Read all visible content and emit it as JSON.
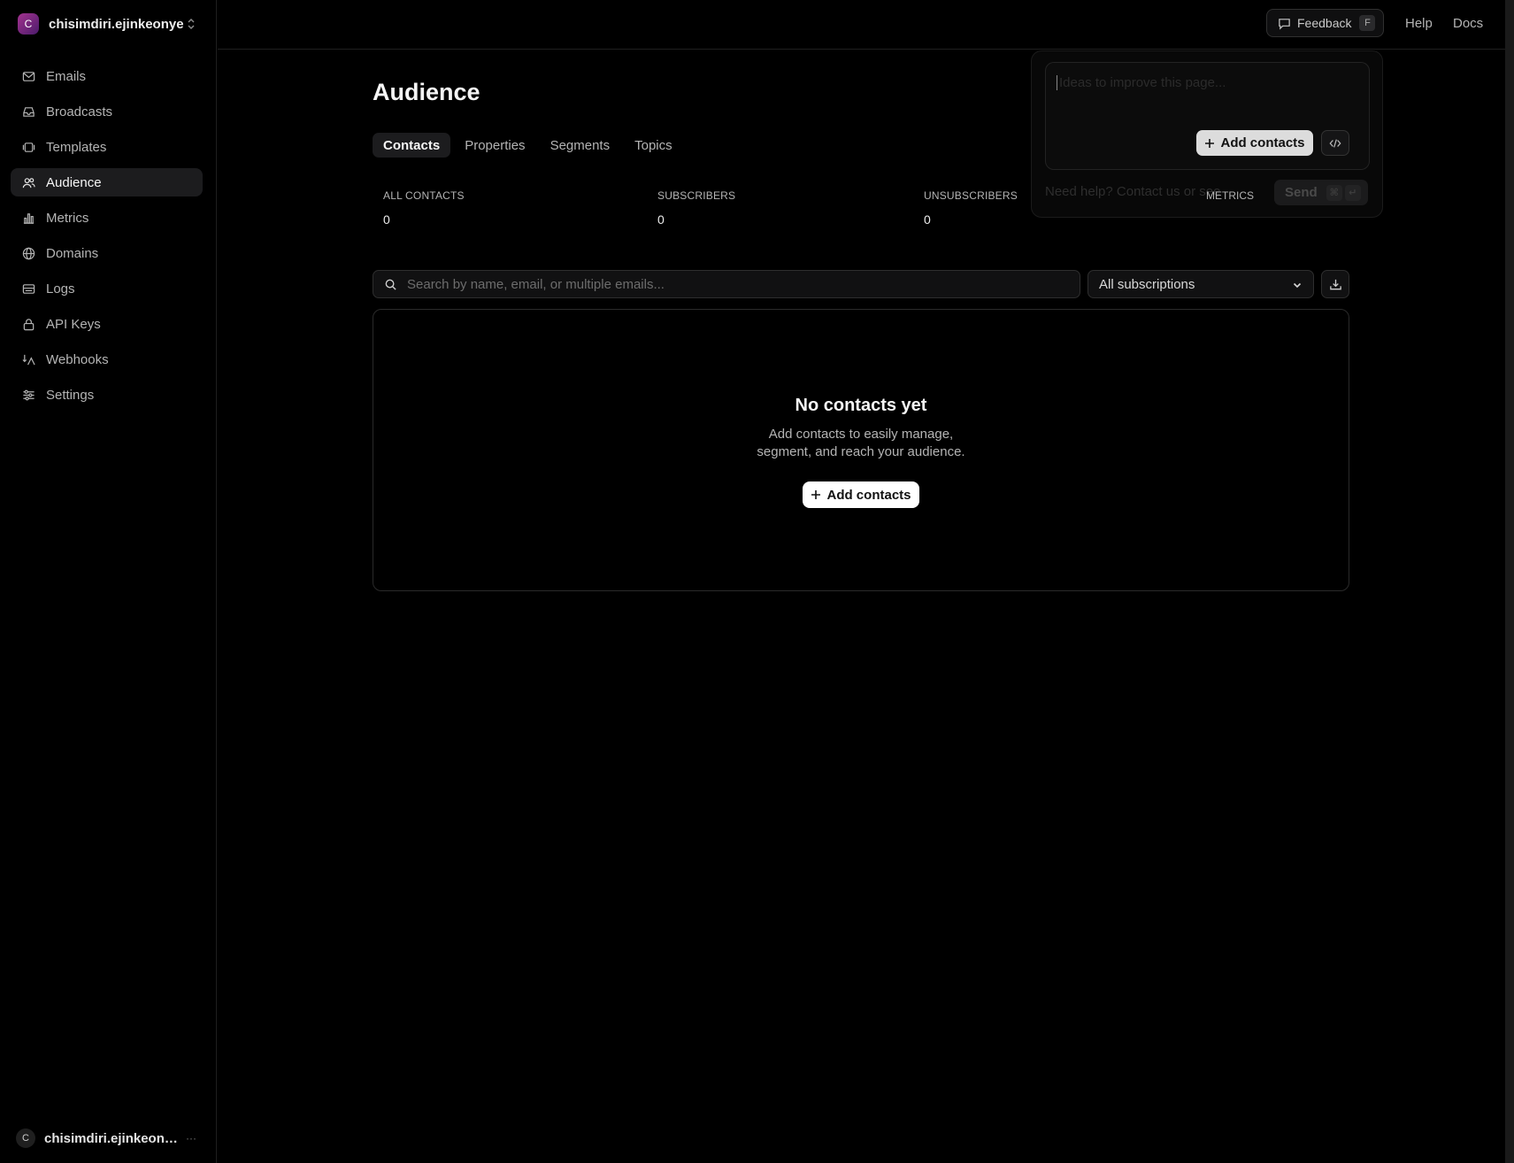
{
  "team": {
    "avatar": "C",
    "name": "chisimdiri.ejinkeonye"
  },
  "nav": [
    {
      "label": "Emails",
      "icon": "mail-icon"
    },
    {
      "label": "Broadcasts",
      "icon": "inbox-icon"
    },
    {
      "label": "Templates",
      "icon": "template-icon"
    },
    {
      "label": "Audience",
      "icon": "users-icon",
      "active": true
    },
    {
      "label": "Metrics",
      "icon": "bar-chart-icon"
    },
    {
      "label": "Domains",
      "icon": "globe-icon"
    },
    {
      "label": "Logs",
      "icon": "logs-icon"
    },
    {
      "label": "API Keys",
      "icon": "lock-icon"
    },
    {
      "label": "Webhooks",
      "icon": "webhook-icon"
    },
    {
      "label": "Settings",
      "icon": "sliders-icon"
    }
  ],
  "user": {
    "avatar": "C",
    "name": "chisimdiri.ejinkeonye...",
    "more": "···"
  },
  "topbar": {
    "feedback": "Feedback",
    "feedback_key": "F",
    "help": "Help",
    "docs": "Docs"
  },
  "page": {
    "title": "Audience"
  },
  "tabs": [
    {
      "label": "Contacts",
      "active": true
    },
    {
      "label": "Properties"
    },
    {
      "label": "Segments"
    },
    {
      "label": "Topics"
    }
  ],
  "stats": [
    {
      "label": "ALL CONTACTS",
      "value": "0"
    },
    {
      "label": "SUBSCRIBERS",
      "value": "0"
    },
    {
      "label": "UNSUBSCRIBERS",
      "value": "0"
    }
  ],
  "search": {
    "placeholder": "Search by name, email, or multiple emails..."
  },
  "filter": {
    "selected": "All subscriptions"
  },
  "empty": {
    "title": "No contacts yet",
    "desc_line1": "Add contacts to easily manage,",
    "desc_line2": "segment, and reach your audience.",
    "button": "Add contacts"
  },
  "popover": {
    "placeholder": "Ideas to improve this page...",
    "add_button": "Add contacts",
    "help": "Need help? Contact us or see",
    "metrics": "METRICS",
    "send": "Send",
    "send_key1": "⌘",
    "send_key2": "↵"
  },
  "colors": {
    "background": "#000000",
    "accent_avatar": "#a3338f",
    "active_bg": "#1c1c1e"
  }
}
